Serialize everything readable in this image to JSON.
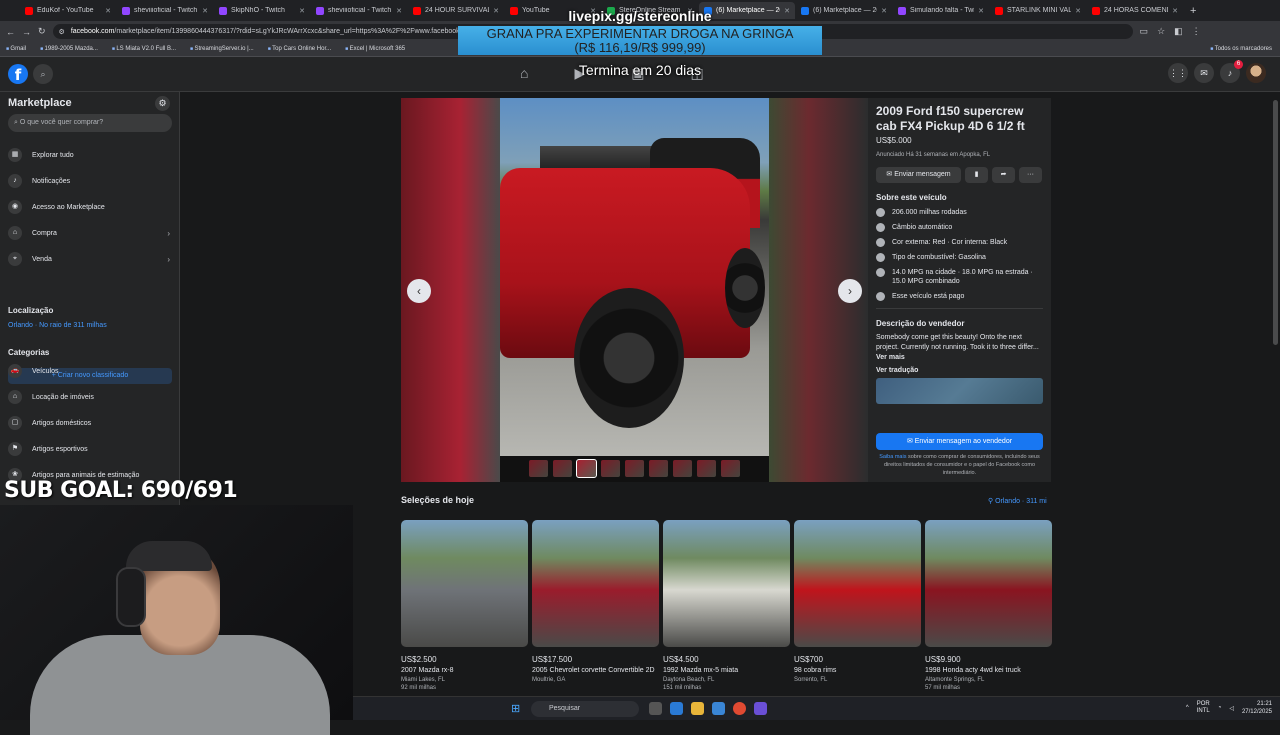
{
  "browser": {
    "tabs": [
      {
        "label": "EduKof - YouTube",
        "color": "#ff0000"
      },
      {
        "label": "sheviiioficial - Twitch",
        "color": "#9146ff"
      },
      {
        "label": "SkipNhO - Twitch",
        "color": "#9146ff"
      },
      {
        "label": "sheviiioficial - Twitch",
        "color": "#9146ff"
      },
      {
        "label": "24 HOUR SURVIVAL IN",
        "color": "#ff0000"
      },
      {
        "label": "YouTube",
        "color": "#ff0000"
      },
      {
        "label": "StereOnline Stream",
        "color": "#1ba94c"
      },
      {
        "label": "(6) Marketplace — 20",
        "color": "#1877f2"
      },
      {
        "label": "(6) Marketplace — 20",
        "color": "#1877f2"
      },
      {
        "label": "Simulando falta - Twit",
        "color": "#9146ff"
      },
      {
        "label": "STARLINK MINI VALE",
        "color": "#ff0000"
      },
      {
        "label": "24 HORAS COMENDO",
        "color": "#ff0000"
      }
    ],
    "active_tab": 7,
    "url_host": "facebook.com",
    "url_path": "/marketplace/item/1399860444376317/?rdid=sLgYkJRcWArrXcxc&share_url=https%3A%2F%2Fwww.facebook...",
    "bookmarks": [
      "Gmail",
      "1989-2005 Mazda...",
      "LS Miata V2.0 Full B...",
      "StreamingServer.io |...",
      "Top Cars Online Hor...",
      "Excel | Microsoft 365"
    ],
    "bookmarks_right": "Todos os marcadores"
  },
  "overlay": {
    "url": "livepix.gg/stereonline",
    "ad_line1": "GRANA PRA EXPERIMENTAR DROGA NA GRINGA",
    "ad_line2": "(R$ 116,19/R$ 999,99)",
    "ends": "Termina em 20 dias"
  },
  "facebook": {
    "logo": "f",
    "notif_count": "6"
  },
  "sidebar": {
    "title": "Marketplace",
    "search_placeholder": "O que você quer comprar?",
    "items": [
      {
        "label": "Explorar tudo",
        "icon": "store-icon"
      },
      {
        "label": "Notificações",
        "icon": "bell-icon"
      },
      {
        "label": "Acesso ao Marketplace",
        "icon": "account-icon"
      },
      {
        "label": "Compra",
        "icon": "bag-icon"
      },
      {
        "label": "Venda",
        "icon": "tag-icon"
      }
    ],
    "create_button": "+ Criar novo classificado",
    "location_heading": "Localização",
    "location_value": "Orlando · No raio de 311 milhas",
    "categories_heading": "Categorias",
    "categories": [
      "Veículos",
      "Locação de imóveis",
      "Artigos domésticos",
      "Artigos esportivos",
      "Artigos para animais de estimação"
    ]
  },
  "subgoal": "SUB GOAL: 690/691",
  "listing": {
    "title": "2009 Ford f150 supercrew cab FX4 Pickup 4D 6 1/2 ft",
    "price": "US$5.000",
    "meta": "Anunciado Há 31 semanas em Apopka, FL",
    "message_button": "Enviar mensagem",
    "about_heading": "Sobre este veículo",
    "specs": [
      "206.000 milhas rodadas",
      "Câmbio automático",
      "Cor externa: Red · Cor interna: Black",
      "Tipo de combustível: Gasolina",
      "14.0 MPG na cidade · 18.0 MPG na estrada · 15.0 MPG combinado",
      "Esse veículo está pago"
    ],
    "seller_heading": "Descrição do vendedor",
    "seller_desc": "Somebody come get this beauty! Onto the next project. Currently not running. Took it to three differ...",
    "see_more": "Ver mais",
    "translate": "Ver tradução",
    "send_button": "Enviar mensagem ao vendedor",
    "legal_link": "Saiba mais",
    "legal_text": "sobre como comprar de consumidores, incluindo seus direitos limitados de consumidor e o papel do Facebook como intermediário."
  },
  "todays_picks": {
    "title": "Seleções de hoje",
    "location": "Orlando · 311 mi",
    "cards": [
      {
        "price": "US$2.500",
        "name": "2007 Mazda rx-8",
        "location": "Miami Lakes, FL",
        "miles": "92 mil milhas",
        "color": "#6f7378"
      },
      {
        "price": "US$17.500",
        "name": "2005 Chevrolet corvette Convertible 2D",
        "location": "Moultrie, GA",
        "miles": "",
        "color": "#9a1c2c"
      },
      {
        "price": "US$4.500",
        "name": "1992 Mazda mx-5 miata",
        "location": "Daytona Beach, FL",
        "miles": "151 mil milhas",
        "color": "#d8d8d0"
      },
      {
        "price": "US$700",
        "name": "98 cobra rims",
        "location": "Sorrento, FL",
        "miles": "",
        "color": "#c0141c"
      },
      {
        "price": "US$9.900",
        "name": "1998 Honda acty 4wd kei truck",
        "location": "Altamonte Springs, FL",
        "miles": "57 mil milhas",
        "color": "#8a1420"
      }
    ]
  },
  "taskbar": {
    "search": "Pesquisar",
    "lang": "POR\nINTL",
    "time": "21:21",
    "date": "27/12/2025"
  }
}
